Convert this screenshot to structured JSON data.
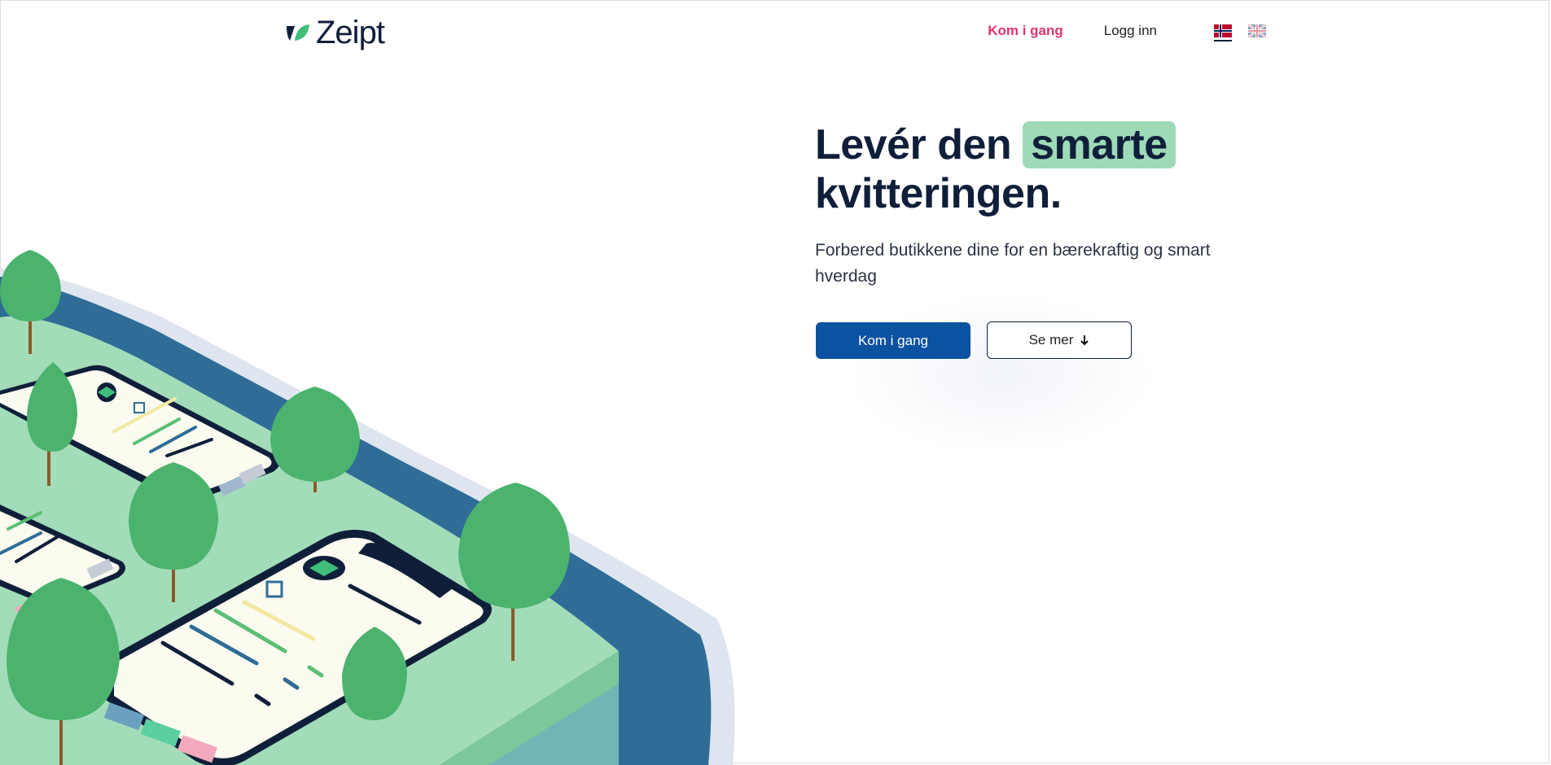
{
  "brand": {
    "name": "Zeipt",
    "accent": "#3fbf7a"
  },
  "nav": {
    "start_label": "Kom i gang",
    "login_label": "Logg inn",
    "languages": [
      {
        "code": "no",
        "icon": "norway-flag-icon",
        "active": true
      },
      {
        "code": "en",
        "icon": "uk-flag-icon",
        "active": false
      }
    ]
  },
  "hero": {
    "headline_pre": "Levér den",
    "headline_highlight": "smarte",
    "headline_post": "kvitteringen.",
    "subtitle": "Forbered butikkene dine for en bærekraftig og smart hverdag",
    "primary_button": "Kom i gang",
    "secondary_button": "Se mer",
    "secondary_icon": "arrow-down-icon"
  },
  "colors": {
    "navy": "#0f1f3a",
    "pink": "#e0336e",
    "primary_blue": "#0b52a0",
    "highlight_green": "#9edab7"
  }
}
